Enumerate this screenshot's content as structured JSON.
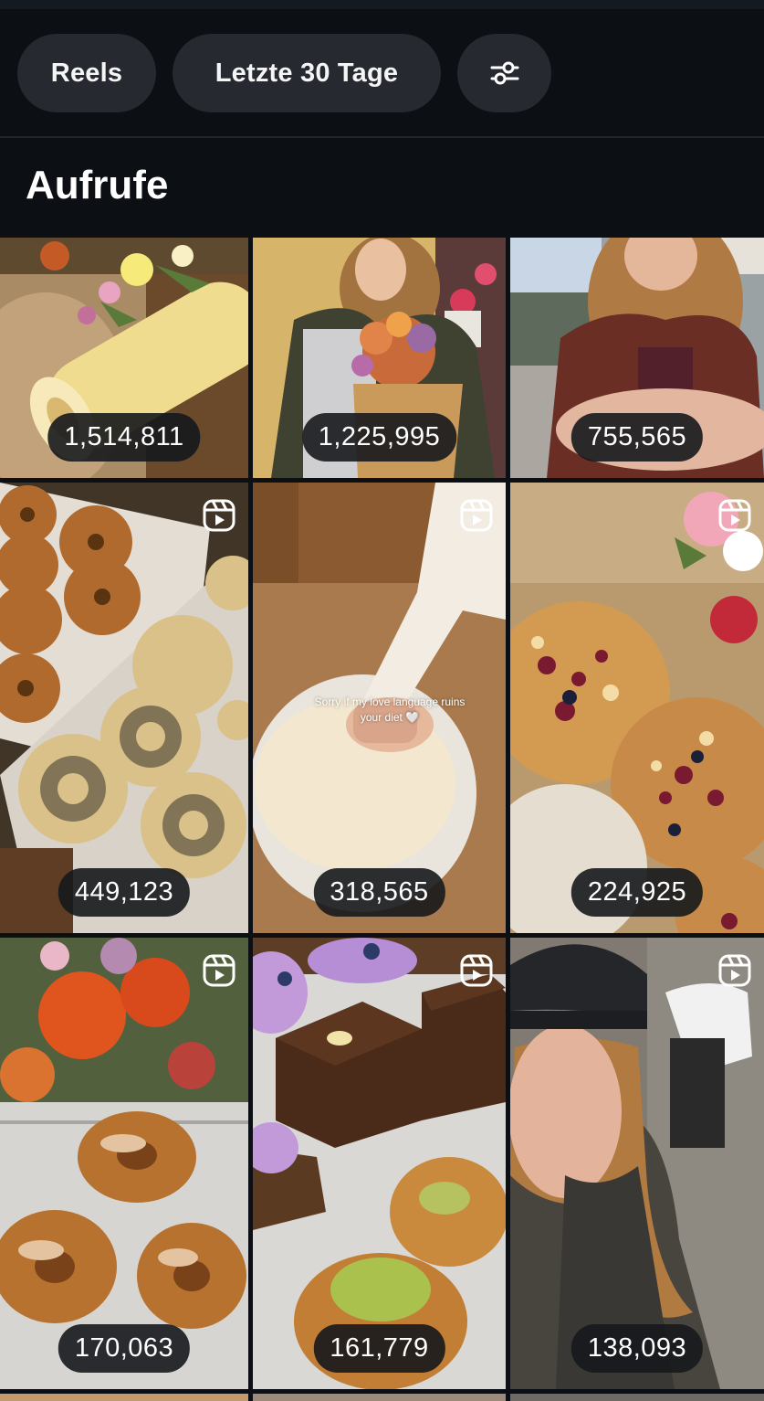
{
  "filters": {
    "type_label": "Reels",
    "range_label": "Letzte 30 Tage",
    "settings_icon": "sliders-icon"
  },
  "section": {
    "title": "Aufrufe"
  },
  "tiles": [
    {
      "views": "1,514,811",
      "subject": "lemon roll cake with flowers",
      "reel": false
    },
    {
      "views": "1,225,995",
      "subject": "woman holding bouquet",
      "reel": false
    },
    {
      "views": "755,565",
      "subject": "woman reaching hand",
      "reel": false
    },
    {
      "views": "449,123",
      "subject": "bagels on trays",
      "reel": true
    },
    {
      "views": "318,565",
      "subject": "hand pressing dough",
      "reel": true,
      "caption": "Sorry if my love language ruins your diet 🤍"
    },
    {
      "views": "224,925",
      "subject": "berry crumble pastries",
      "reel": true
    },
    {
      "views": "170,063",
      "subject": "cinnamon knots with orange roses",
      "reel": true
    },
    {
      "views": "161,779",
      "subject": "chocolate cake slices",
      "reel": true
    },
    {
      "views": "138,093",
      "subject": "woman selfie with beret",
      "reel": true
    }
  ],
  "colors": {
    "background": "#0c1014",
    "chip": "#262a30",
    "badge": "#16181c"
  }
}
